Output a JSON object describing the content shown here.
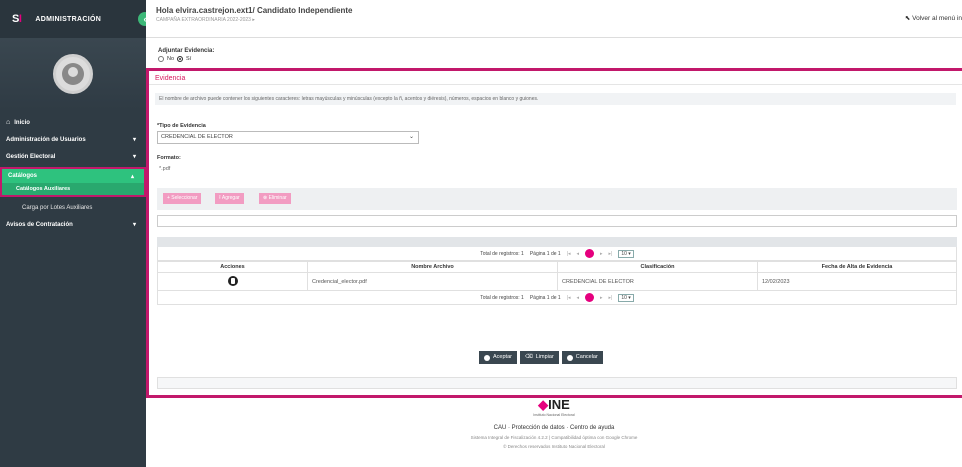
{
  "brand": {
    "logo_s": "S",
    "logo_i": "I",
    "title": "ADMINISTRACIÓN",
    "collapse": "‹"
  },
  "header": {
    "greeting": "Hola elvira.castrejon.ext1/ Candidato Independiente",
    "subtitle": "CAMPAÑA EXTRAORDINARIA 2022-2023 ▸",
    "back_label": "Volver al menú in",
    "back_icon": "back-arrow-icon"
  },
  "sidebar": {
    "inicio": "Inicio",
    "admin_usuarios": "Administración de Usuarios",
    "gestion_electoral": "Gestión Electoral",
    "catalogos": "Catálogos",
    "catalogos_auxiliares": "Catálogos Auxiliares",
    "carga_lotes": "Carga por Lotes Auxiliares",
    "avisos_contratacion": "Avisos de Contratación"
  },
  "form": {
    "adjuntar_label": "Adjuntar Evidencia:",
    "radio_no": "No",
    "radio_si": "Sí",
    "section_title": "Evidencia",
    "info_text": "El nombre de archivo puede contener los siguientes caracteres: letras mayúsculas y minúsculas (excepto la ñ, acentos y diéresis), números, espacios en blanco y guiones.",
    "tipo_label": "*Tipo de Evidencia",
    "tipo_value": "CREDENCIAL DE ELECTOR",
    "formato_label": "Formato:",
    "formato_value": "*.pdf",
    "btn_seleccionar": "+ Seleccionar",
    "btn_agregar": "⭱ Agregar",
    "btn_eliminar": "⊗ Eliminar"
  },
  "table": {
    "total_label": "Total de registros: 1",
    "page_label": "Página 1 de 1",
    "page_size": "10 ▾",
    "columns": [
      "Acciones",
      "Nombre Archivo",
      "Clasificación",
      "Fecha de Alta de Evidencia"
    ],
    "row": {
      "file": "Credencial_elector.pdf",
      "clasificacion": "CREDENCIAL DE ELECTOR",
      "fecha": "12/02/2023"
    }
  },
  "actions": {
    "aceptar": "Aceptar",
    "limpiar": "Limpiar",
    "cancelar": "Cancelar"
  },
  "footer": {
    "ine": "INE",
    "ine_sub": "Instituto Nacional Electoral",
    "links": "CAU · Protección de datos · Centro de ayuda",
    "meta1": "Sistema Integral de Fiscalización 4.2.2 | Compatibilidad óptima con Google Chrome",
    "meta2": "© Derechos reservados Instituto Nacional Electoral"
  },
  "colors": {
    "accent": "#c2186b",
    "pink": "#e5007e",
    "green": "#2ec27e",
    "sidebar": "#2f3b44"
  }
}
